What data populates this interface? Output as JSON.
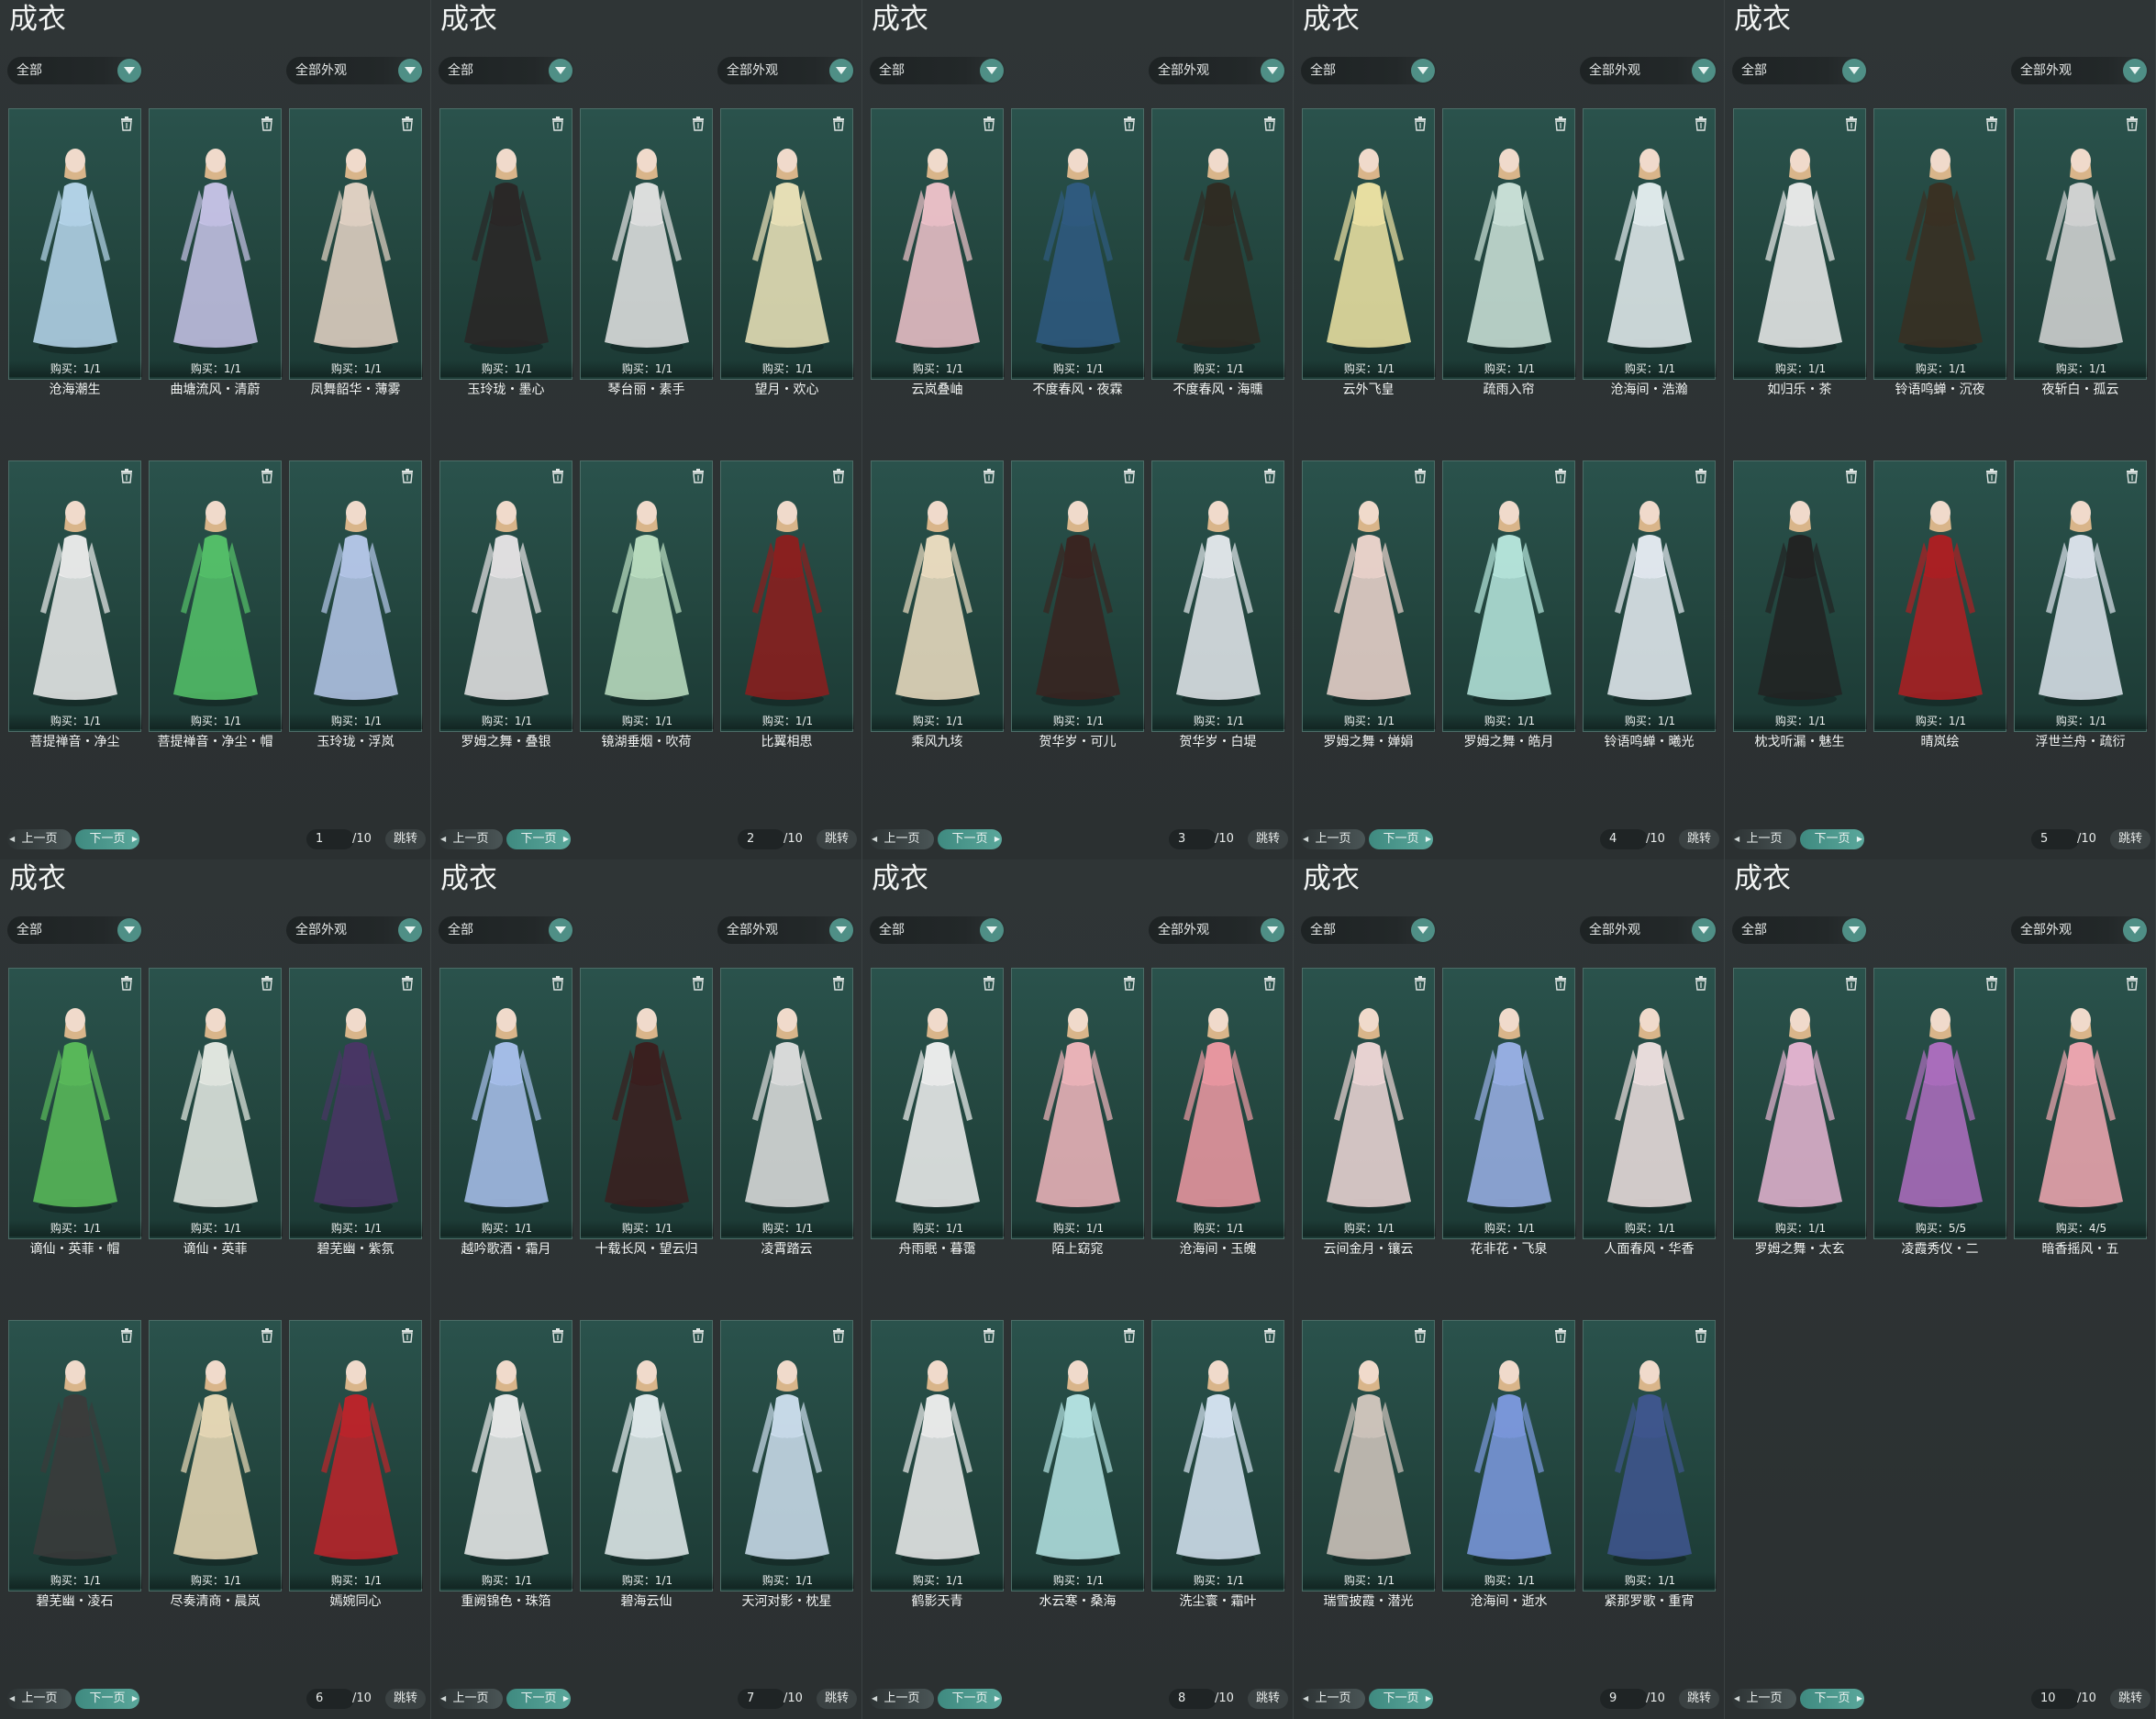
{
  "panel_title": "成衣",
  "filter_left": "全部",
  "filter_right": "全部外观",
  "buy_prefix": "购买：",
  "pager": {
    "prev": "上一页",
    "next": "下一页",
    "jump": "跳转",
    "total": "/10"
  },
  "panels": [
    {
      "page": "1",
      "items": [
        {
          "name": "沧海潮生",
          "buy": "1/1",
          "color": "#b8d8ee"
        },
        {
          "name": "曲塘流风・清蔚",
          "buy": "1/1",
          "color": "#c9c5ea"
        },
        {
          "name": "凤舞韶华・薄雾",
          "buy": "1/1",
          "color": "#e7d6c8"
        },
        {
          "name": "菩提禅音・净尘",
          "buy": "1/1",
          "color": "#eeeeee"
        },
        {
          "name": "菩提禅音・净尘・帽",
          "buy": "1/1",
          "color": "#55c36a"
        },
        {
          "name": "玉玲珑・浮岚",
          "buy": "1/1",
          "color": "#b7c9ec"
        }
      ]
    },
    {
      "page": "2",
      "items": [
        {
          "name": "玉玲珑・墨心",
          "buy": "1/1",
          "color": "#2a2626"
        },
        {
          "name": "琴台丽・素手",
          "buy": "1/1",
          "color": "#e5e5e5"
        },
        {
          "name": "望月・欢心",
          "buy": "1/1",
          "color": "#efe6bc"
        },
        {
          "name": "罗姆之舞・叠银",
          "buy": "1/1",
          "color": "#e9e6e8"
        },
        {
          "name": "镜湖垂烟・吹荷",
          "buy": "1/1",
          "color": "#bfe2c4"
        },
        {
          "name": "比翼相思",
          "buy": "1/1",
          "color": "#8e1d1d"
        }
      ]
    },
    {
      "page": "3",
      "items": [
        {
          "name": "云岚叠岫",
          "buy": "1/1",
          "color": "#f1c4cc"
        },
        {
          "name": "不度春风・夜霖",
          "buy": "1/1",
          "color": "#2f5b82"
        },
        {
          "name": "不度春风・海曛",
          "buy": "1/1",
          "color": "#2f2a22"
        },
        {
          "name": "乘风九垓",
          "buy": "1/1",
          "color": "#f0e0c4"
        },
        {
          "name": "贺华岁・可儿",
          "buy": "1/1",
          "color": "#3a2320"
        },
        {
          "name": "贺华岁・白堤",
          "buy": "1/1",
          "color": "#e6eaee"
        }
      ]
    },
    {
      "page": "4",
      "items": [
        {
          "name": "云外飞皇",
          "buy": "1/1",
          "color": "#f1e6a6"
        },
        {
          "name": "疏雨入帘",
          "buy": "1/1",
          "color": "#cfe5dc"
        },
        {
          "name": "沧海间・浩瀚",
          "buy": "1/1",
          "color": "#e7f0f2"
        },
        {
          "name": "罗姆之舞・婵娟",
          "buy": "1/1",
          "color": "#f0d7d0"
        },
        {
          "name": "罗姆之舞・皓月",
          "buy": "1/1",
          "color": "#b9e9df"
        },
        {
          "name": "铃语鸣蝉・曦光",
          "buy": "1/1",
          "color": "#e9eef5"
        }
      ]
    },
    {
      "page": "5",
      "items": [
        {
          "name": "如归乐・茶",
          "buy": "1/1",
          "color": "#eeeeee"
        },
        {
          "name": "铃语鸣蝉・沉夜",
          "buy": "1/1",
          "color": "#3a2f22"
        },
        {
          "name": "夜斩白・孤云",
          "buy": "1/1",
          "color": "#d8d8d8"
        },
        {
          "name": "枕戈听漏・魅生",
          "buy": "1/1",
          "color": "#222222"
        },
        {
          "name": "晴岚绘",
          "buy": "1/1",
          "color": "#b01e22"
        },
        {
          "name": "浮世兰舟・疏衍",
          "buy": "1/1",
          "color": "#dfe6ef"
        }
      ]
    },
    {
      "page": "6",
      "items": [
        {
          "name": "谪仙・英菲・帽",
          "buy": "1/1",
          "color": "#5bbd5b"
        },
        {
          "name": "谪仙・英菲",
          "buy": "1/1",
          "color": "#e8ece6"
        },
        {
          "name": "碧芜幽・紫氛",
          "buy": "1/1",
          "color": "#4a3566"
        },
        {
          "name": "碧芜幽・凌石",
          "buy": "1/1",
          "color": "#3b3b3b"
        },
        {
          "name": "尽奏清商・晨岚",
          "buy": "1/1",
          "color": "#ecdcb9"
        },
        {
          "name": "嫣婉同心",
          "buy": "1/1",
          "color": "#c0232a"
        }
      ]
    },
    {
      "page": "7",
      "items": [
        {
          "name": "越吟歌酒・霜月",
          "buy": "1/1",
          "color": "#aac2ef"
        },
        {
          "name": "十载长风・望云归",
          "buy": "1/1",
          "color": "#3b1e1e"
        },
        {
          "name": "凌霄踏云",
          "buy": "1/1",
          "color": "#e0e0e0"
        },
        {
          "name": "重阙锦色・珠箔",
          "buy": "1/1",
          "color": "#eeeeee"
        },
        {
          "name": "碧海云仙",
          "buy": "1/1",
          "color": "#e6eef0"
        },
        {
          "name": "天河对影・枕星",
          "buy": "1/1",
          "color": "#cfe0f0"
        }
      ]
    },
    {
      "page": "8",
      "items": [
        {
          "name": "舟雨眠・暮霭",
          "buy": "1/1",
          "color": "#f2f2f2"
        },
        {
          "name": "陌上窈窕",
          "buy": "1/1",
          "color": "#f2b7be"
        },
        {
          "name": "沧海间・玉魄",
          "buy": "1/1",
          "color": "#f09aa4"
        },
        {
          "name": "鹤影天青",
          "buy": "1/1",
          "color": "#f0f0f0"
        },
        {
          "name": "水云寒・桑海",
          "buy": "1/1",
          "color": "#b7e6e6"
        },
        {
          "name": "洗尘寰・霜叶",
          "buy": "1/1",
          "color": "#d8e6f4"
        }
      ]
    },
    {
      "page": "9",
      "items": [
        {
          "name": "云间金月・镶云",
          "buy": "1/1",
          "color": "#f1d9d9"
        },
        {
          "name": "花非花・飞泉",
          "buy": "1/1",
          "color": "#9bb2e9"
        },
        {
          "name": "人面春风・华香",
          "buy": "1/1",
          "color": "#f1e3e3"
        },
        {
          "name": "瑞雪披霞・潜光",
          "buy": "1/1",
          "color": "#d4c8c0"
        },
        {
          "name": "沧海间・逝水",
          "buy": "1/1",
          "color": "#7d9ae0"
        },
        {
          "name": "紧那罗歌・重宵",
          "buy": "1/1",
          "color": "#3f5690"
        }
      ]
    },
    {
      "page": "10",
      "items": [
        {
          "name": "罗姆之舞・太玄",
          "buy": "1/1",
          "color": "#e8b6d4"
        },
        {
          "name": "凌霞秀仪・二",
          "buy": "5/5",
          "color": "#b06fc2"
        },
        {
          "name": "暗香摇风・五",
          "buy": "4/5",
          "color": "#f3a9b4"
        }
      ]
    }
  ]
}
